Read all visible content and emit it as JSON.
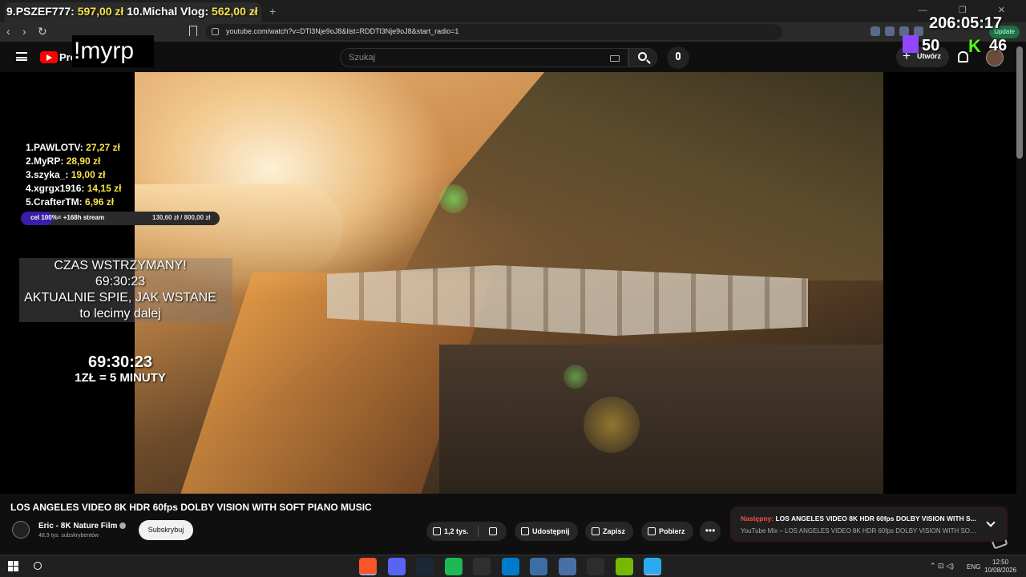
{
  "browser": {
    "tab_close": "×",
    "tab_new": "+",
    "window_controls": "— ❐ ✕",
    "nav_back": "‹",
    "nav_forward": "›",
    "nav_reload": "↻",
    "url": "youtube.com/watch?v=DTl3Nje9oJ8&list=RDDTl3Nje9oJ8&start_radio=1",
    "update_label": "Update"
  },
  "youtube": {
    "logo_text": "Pre",
    "search_placeholder": "Szukaj",
    "create_plus": "+",
    "create_label": "Utwórz"
  },
  "overlay": {
    "top_ticker": {
      "rank9": "9.",
      "name9": "PSZEF777:",
      "amount9": "597,00 zł",
      "rank10": "10.",
      "name10": "Michal Vlog:",
      "amount10": "562,00 zł"
    },
    "top_timer": "206:05:17",
    "myrp": "!myrp",
    "twitch_count": "50",
    "kick_logo": "K",
    "kick_count": "46",
    "leaderboard": [
      {
        "label": "1.PAWLOTV:",
        "amount": "27,27 zł"
      },
      {
        "label": "2.MyRP:",
        "amount": "28,90 zł"
      },
      {
        "label": "3.szyka_:",
        "amount": "19,00 zł"
      },
      {
        "label": "4.xgrgx1916:",
        "amount": "14,15 zł"
      },
      {
        "label": "5.CrafterTM:",
        "amount": "6,96 zł"
      }
    ],
    "goal": {
      "label": "cel 100%= +168h stream",
      "amounts": "130,60 zł / 800,00 zł",
      "fraction": 0.163
    },
    "paused_lines": [
      "CZAS WSTRZYMANY!",
      "69:30:23",
      "AKTUALNIE SPIE, JAK WSTANE",
      "to lecimy dalej"
    ],
    "big_timer": "69:30:23",
    "rate": "1ZŁ = 5 MINUTY"
  },
  "video": {
    "title": "LOS ANGELES VIDEO 8K HDR 60fps DOLBY VISION WITH SOFT PIANO MUSIC",
    "channel": "Eric - 8K Nature Film",
    "subscribers": "48,9 tys. subskrybentów",
    "subscribe_label": "Subskrybuj",
    "likes": "1,2 tys.",
    "share_label": "Udostępnij",
    "save_label": "Zapisz",
    "download_label": "Pobierz",
    "more_label": "•••"
  },
  "next_up": {
    "prefix": "Następny: ",
    "title": "LOS ANGELES VIDEO 8K HDR 60fps DOLBY VISION WITH S...",
    "subtitle": "YouTube Mix – LOS ANGELES VIDEO 8K HDR 60fps DOLBY VISION WITH SOFT PI..."
  },
  "taskbar": {
    "tray_icons": "⌃  ⊡  ◁)",
    "language": "ENG",
    "time": "12:50",
    "date": "10/08/2026",
    "apps": [
      {
        "name": "brave",
        "color": "#fb542b"
      },
      {
        "name": "discord",
        "color": "#5865f2"
      },
      {
        "name": "steam",
        "color": "#1b2838"
      },
      {
        "name": "spotify",
        "color": "#1db954"
      },
      {
        "name": "obs",
        "color": "#302e31"
      },
      {
        "name": "vscode",
        "color": "#007acc"
      },
      {
        "name": "app-7",
        "color": "#3a6ea5"
      },
      {
        "name": "app-8",
        "color": "#4a6fa5"
      },
      {
        "name": "terminal",
        "color": "#2d2d2d"
      },
      {
        "name": "nvidia",
        "color": "#76b900"
      },
      {
        "name": "telegram",
        "color": "#2aabee"
      }
    ]
  },
  "colors": {
    "accent_red": "#ff0000",
    "overlay_yellow": "#f7e34a",
    "goal_fill": "#3a1da8",
    "twitch": "#9146ff",
    "kick": "#53fc18"
  }
}
